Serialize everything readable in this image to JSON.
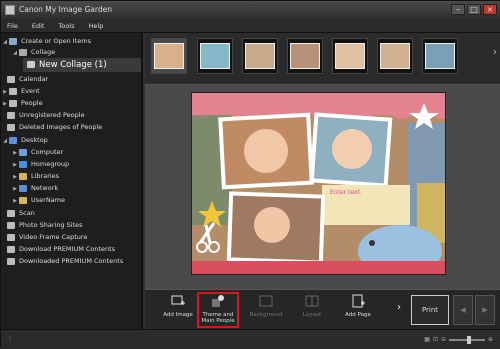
{
  "window": {
    "title": "Canon My Image Garden"
  },
  "menu": [
    "File",
    "Edit",
    "Tools",
    "Help"
  ],
  "sidebar": {
    "items": [
      {
        "label": "Create or Open Items",
        "icon": "folder-icon"
      },
      {
        "label": "Collage",
        "icon": "collage-icon"
      },
      {
        "label": "New Collage (1)",
        "icon": "collage-icon"
      },
      {
        "label": "Calendar",
        "icon": "calendar-icon"
      },
      {
        "label": "Event",
        "icon": "event-icon"
      },
      {
        "label": "People",
        "icon": "people-icon"
      },
      {
        "label": "Unregistered People",
        "icon": "person-icon"
      },
      {
        "label": "Deleted Images of People",
        "icon": "person-icon"
      },
      {
        "label": "Desktop",
        "icon": "desktop-icon"
      },
      {
        "label": "Computer",
        "icon": "computer-icon"
      },
      {
        "label": "Homegroup",
        "icon": "homegroup-icon"
      },
      {
        "label": "Libraries",
        "icon": "library-icon"
      },
      {
        "label": "Network",
        "icon": "network-icon"
      },
      {
        "label": "UserName",
        "icon": "user-icon"
      },
      {
        "label": "Scan",
        "icon": "scan-icon"
      },
      {
        "label": "Photo Sharing Sites",
        "icon": "sharing-icon"
      },
      {
        "label": "Video Frame Capture",
        "icon": "video-icon"
      },
      {
        "label": "Download PREMIUM Contents",
        "icon": "download-icon"
      },
      {
        "label": "Downloaded PREMIUM Contents",
        "icon": "folder-icon"
      }
    ]
  },
  "canvas": {
    "text_placeholder": "Enter text."
  },
  "toolbar": {
    "add_image": "Add Image",
    "theme_line1": "Theme and",
    "theme_line2": "Main People",
    "background": "Background",
    "layout": "Layout",
    "add_page": "Add Page",
    "print": "Print"
  }
}
